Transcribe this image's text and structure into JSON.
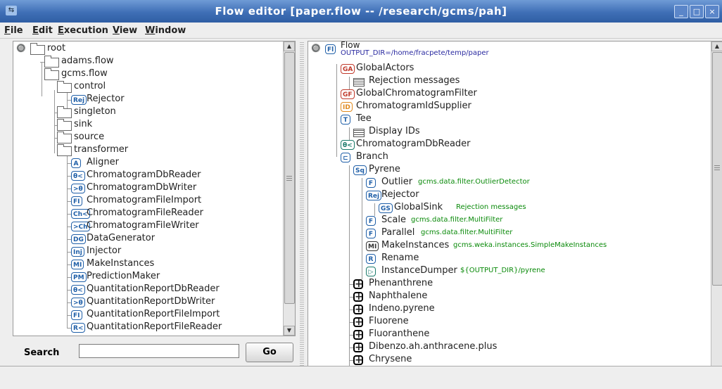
{
  "window": {
    "title": "Flow editor [paper.flow -- /research/gcms/pah]",
    "app_icon": "flow-app-icon",
    "controls": [
      "minimize",
      "maximize",
      "close"
    ]
  },
  "menubar": [
    "File",
    "Edit",
    "Execution",
    "View",
    "Window"
  ],
  "left_tree": {
    "root": "root",
    "adams_flow": "adams.flow",
    "gcms_flow": "gcms.flow",
    "control": "control",
    "rejector": "Rejector",
    "singleton": "singleton",
    "sink": "sink",
    "source": "source",
    "transformer": "transformer",
    "transformers": [
      {
        "badge": "A",
        "label": "Aligner"
      },
      {
        "badge": "θ<",
        "label": "ChromatogramDbReader"
      },
      {
        "badge": ">θ",
        "label": "ChromatogramDbWriter"
      },
      {
        "badge": "FI",
        "label": "ChromatogramFileImport"
      },
      {
        "badge": "Ch<",
        "label": "ChromatogramFileReader"
      },
      {
        "badge": ">Ch",
        "label": "ChromatogramFileWriter"
      },
      {
        "badge": "DG",
        "label": "DataGenerator"
      },
      {
        "badge": "Inj",
        "label": "Injector"
      },
      {
        "badge": "MI",
        "label": "MakeInstances"
      },
      {
        "badge": "PM",
        "label": "PredictionMaker"
      },
      {
        "badge": "θ<",
        "label": "QuantitationReportDbReader"
      },
      {
        "badge": ">θ",
        "label": "QuantitationReportDbWriter"
      },
      {
        "badge": "FI",
        "label": "QuantitationReportFileImport"
      },
      {
        "badge": "R<",
        "label": "QuantitationReportFileReader"
      }
    ]
  },
  "search": {
    "label": "Search",
    "value": "",
    "go": "Go"
  },
  "flow_tree": {
    "flow_label": "Flow",
    "flow_option": "OUTPUT_DIR=/home/fracpete/temp/paper",
    "global_actors": "GlobalActors",
    "rejection_messages": "Rejection messages",
    "global_chrom_filter": "GlobalChromatogramFilter",
    "chrom_id_supplier": "ChromatogramIdSupplier",
    "tee": "Tee",
    "display_ids": "Display IDs",
    "chrom_db_reader": "ChromatogramDbReader",
    "branch": "Branch",
    "pyrene": "Pyrene",
    "outlier": "Outlier",
    "outlier_opt": "gcms.data.filter.OutlierDetector",
    "rejector": "Rejector",
    "global_sink": "GlobalSink",
    "global_sink_opt": "Rejection messages",
    "scale": "Scale",
    "scale_opt": "gcms.data.filter.MultiFilter",
    "parallel": "Parallel",
    "parallel_opt": "gcms.data.filter.MultiFilter",
    "make_instances": "MakeInstances",
    "make_instances_opt": "gcms.weka.instances.SimpleMakeInstances",
    "rename": "Rename",
    "instance_dumper": "InstanceDumper",
    "instance_dumper_opt": "${OUTPUT_DIR}/pyrene",
    "collapsed": [
      "Phenanthrene",
      "Naphthalene",
      "Indeno.pyrene",
      "Fluorene",
      "Fluoranthene",
      "Dibenzo.ah.anthracene.plus",
      "Chrysene"
    ]
  },
  "badge_colors": {
    "global_actors": "#c0392b",
    "global_filter": "#c0392b",
    "id_supplier": "#e08a1e",
    "default": "#1f5fa8"
  },
  "status": ""
}
